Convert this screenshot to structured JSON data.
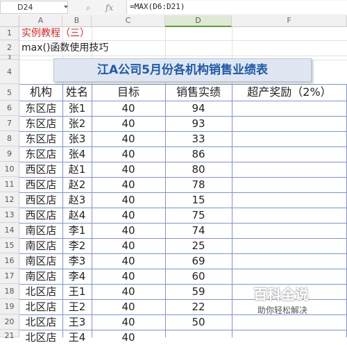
{
  "formula_bar": {
    "cell_ref": "D24",
    "fx_label": "fx",
    "formula": "=MAX(D6:D21)"
  },
  "columns": [
    "A",
    "B",
    "C",
    "D",
    "F"
  ],
  "rows": [
    "1",
    "2",
    "3",
    "4",
    "5",
    "6",
    "7",
    "8",
    "9",
    "10",
    "11",
    "12",
    "13",
    "14",
    "15",
    "16",
    "17",
    "18",
    "19",
    "20",
    "21"
  ],
  "sheet": {
    "a1": "实例教程（三）",
    "a2": "max()函数使用技巧",
    "banner": "江A公司5月份各机构销售业绩表",
    "headers": {
      "org": "机构",
      "name": "姓名",
      "target": "目标",
      "sales": "销售实绩",
      "bonus": "超产奖励（2%）"
    },
    "data_rows": [
      {
        "org": "东区店",
        "name": "张1",
        "target": "40",
        "sales": "94"
      },
      {
        "org": "东区店",
        "name": "张2",
        "target": "40",
        "sales": "93"
      },
      {
        "org": "东区店",
        "name": "张3",
        "target": "40",
        "sales": "33"
      },
      {
        "org": "东区店",
        "name": "张4",
        "target": "40",
        "sales": "86"
      },
      {
        "org": "西区店",
        "name": "赵1",
        "target": "40",
        "sales": "80"
      },
      {
        "org": "西区店",
        "name": "赵2",
        "target": "40",
        "sales": "78"
      },
      {
        "org": "西区店",
        "name": "赵3",
        "target": "40",
        "sales": "15"
      },
      {
        "org": "西区店",
        "name": "赵4",
        "target": "40",
        "sales": "75"
      },
      {
        "org": "南区店",
        "name": "李1",
        "target": "40",
        "sales": "74"
      },
      {
        "org": "南区店",
        "name": "李2",
        "target": "40",
        "sales": "25"
      },
      {
        "org": "南区店",
        "name": "李3",
        "target": "40",
        "sales": "69"
      },
      {
        "org": "南区店",
        "name": "李4",
        "target": "40",
        "sales": "60"
      },
      {
        "org": "北区店",
        "name": "王1",
        "target": "40",
        "sales": "59"
      },
      {
        "org": "北区店",
        "name": "王2",
        "target": "40",
        "sales": "22"
      },
      {
        "org": "北区店",
        "name": "王3",
        "target": "40",
        "sales": "50"
      },
      {
        "org": "北区店",
        "name": "王4",
        "target": "40",
        "sales": ""
      }
    ]
  },
  "watermark": {
    "title": "百科全说",
    "subtitle": "助你轻松解决"
  }
}
